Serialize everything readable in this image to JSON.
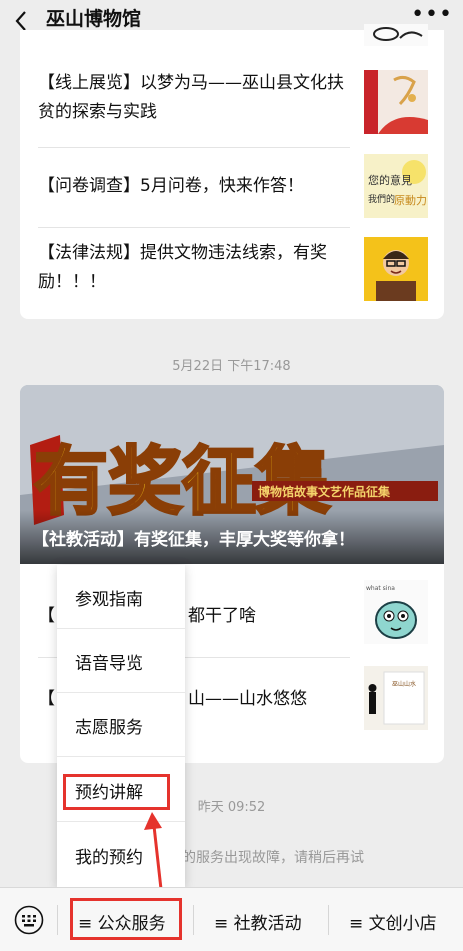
{
  "header": {
    "title": "巫山博物馆",
    "back_icon": "chevron-left-icon",
    "more_icon": "more-dots-icon"
  },
  "articles": [
    {
      "title": "【线上展览】以梦为马——巫山县文化扶贫的探索与实践"
    },
    {
      "title": "【问卷调查】5月问卷，快来作答！",
      "thumb_text": "您的意见 我們的原動力"
    },
    {
      "title": "【法律法规】提供文物违法线索，有奖励！！！"
    }
  ],
  "timestamp_1": "5月22日 下午17:48",
  "banner": {
    "big_text": "有奖征集",
    "sub_text": "博物馆故事文艺作品征集",
    "title": "【社教活动】有奖征集，丰厚大奖等你拿！"
  },
  "articles2": [
    {
      "prefix": "【",
      "suffix": "都干了啥"
    },
    {
      "prefix": "【",
      "suffix": "山——山水悠悠"
    }
  ],
  "timestamp_2": "昨天 09:52",
  "system_message": "的服务出现故障，请稍后再试",
  "popup_menu": {
    "items": [
      "参观指南",
      "语音导览",
      "志愿服务",
      "预约讲解",
      "我的预约"
    ],
    "highlighted_index": 3
  },
  "bottom_bar": {
    "keyboard_icon": "keyboard-icon",
    "tabs": [
      {
        "label": "≡ 公众服务",
        "highlighted": true
      },
      {
        "label": "≡ 社教活动"
      },
      {
        "label": "≡ 文创小店"
      }
    ]
  },
  "colors": {
    "annotation_red": "#e5332d",
    "background": "#ededed",
    "banner_yellow": "#f2c318"
  }
}
